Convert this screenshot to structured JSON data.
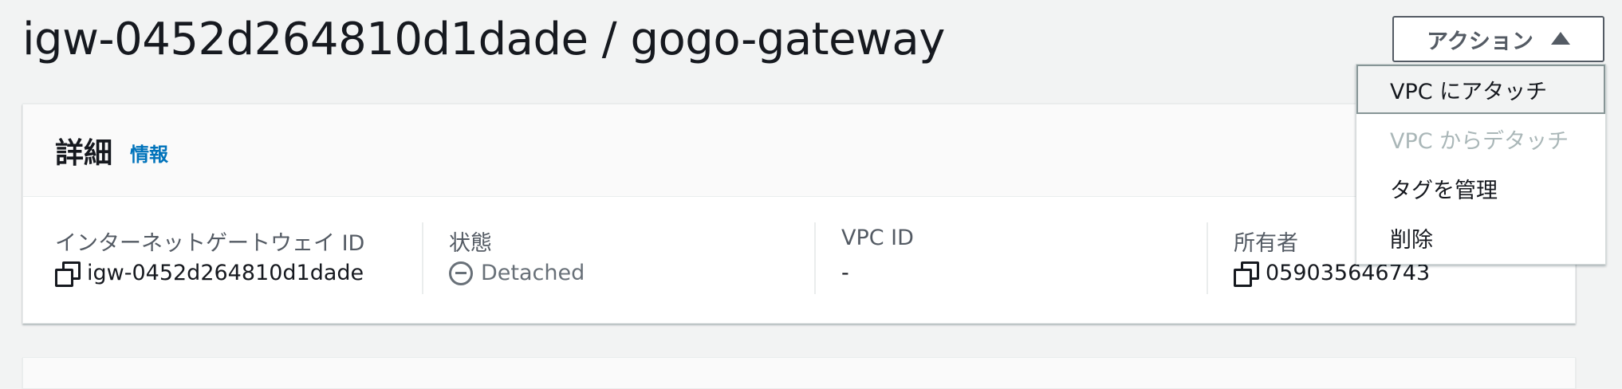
{
  "header": {
    "title": "igw-0452d264810d1dade / gogo-gateway",
    "actions_label": "アクション"
  },
  "actions_menu": {
    "items": [
      {
        "label": "VPC にアタッチ",
        "state": "highlighted"
      },
      {
        "label": "VPC からデタッチ",
        "state": "disabled"
      },
      {
        "label": "タグを管理",
        "state": "enabled"
      },
      {
        "label": "削除",
        "state": "enabled"
      }
    ]
  },
  "details": {
    "title": "詳細",
    "info_link": "情報",
    "fields": [
      {
        "label": "インターネットゲートウェイ ID",
        "value": "igw-0452d264810d1dade",
        "icon": "copy-icon"
      },
      {
        "label": "状態",
        "value": "Detached",
        "icon": "minus-circle-icon"
      },
      {
        "label": "VPC ID",
        "value": "-"
      },
      {
        "label": "所有者",
        "value": "059035646743",
        "icon": "copy-icon"
      }
    ]
  },
  "colors": {
    "page_background": "#f2f3f3",
    "text_primary": "#16191f",
    "text_secondary": "#545b64",
    "link": "#0073bb",
    "status_stopped": "#687078",
    "disabled_text": "#aab7b8"
  }
}
